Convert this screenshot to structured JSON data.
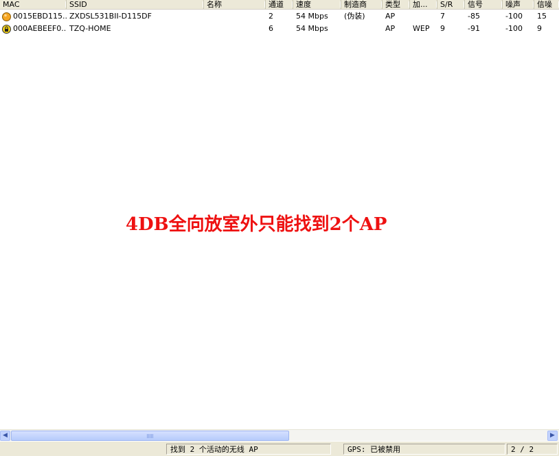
{
  "columns": [
    {
      "label": "MAC"
    },
    {
      "label": "SSID"
    },
    {
      "label": "名称"
    },
    {
      "label": "通道"
    },
    {
      "label": "速度"
    },
    {
      "label": "制造商"
    },
    {
      "label": "类型"
    },
    {
      "label": "加..."
    },
    {
      "label": "S/R"
    },
    {
      "label": "信号"
    },
    {
      "label": "噪声"
    },
    {
      "label": "信噪"
    }
  ],
  "rows": [
    {
      "icon": "ap-open-status-icon",
      "mac": "0015EBD115...",
      "ssid": "ZXDSL531BII-D115DF",
      "name": "",
      "channel": "2",
      "speed": "54 Mbps",
      "vendor": "(伪装)",
      "type": "AP",
      "encryption": "",
      "sr": "7",
      "signal": "-85",
      "noise": "-100",
      "snr": "15"
    },
    {
      "icon": "ap-locked-status-icon",
      "mac": "000AEBEEF0...",
      "ssid": "TZQ-HOME",
      "name": "",
      "channel": "6",
      "speed": "54 Mbps",
      "vendor": "",
      "type": "AP",
      "encryption": "WEP",
      "sr": "9",
      "signal": "-91",
      "noise": "-100",
      "snr": "9"
    }
  ],
  "overlay": {
    "text": "4DB全向放室外只能找到2个AP"
  },
  "status_bar": {
    "found": "找到 2 个活动的无线 AP",
    "gps": "GPS: 已被禁用",
    "count": "2 / 2"
  },
  "icons": {
    "scroll_left": "scroll-left-arrow-icon",
    "scroll_right": "scroll-right-arrow-icon"
  },
  "colors": {
    "overlay_text": "#ee1111",
    "ap_open": "#f5a623",
    "ap_locked": "#f2d21a"
  }
}
